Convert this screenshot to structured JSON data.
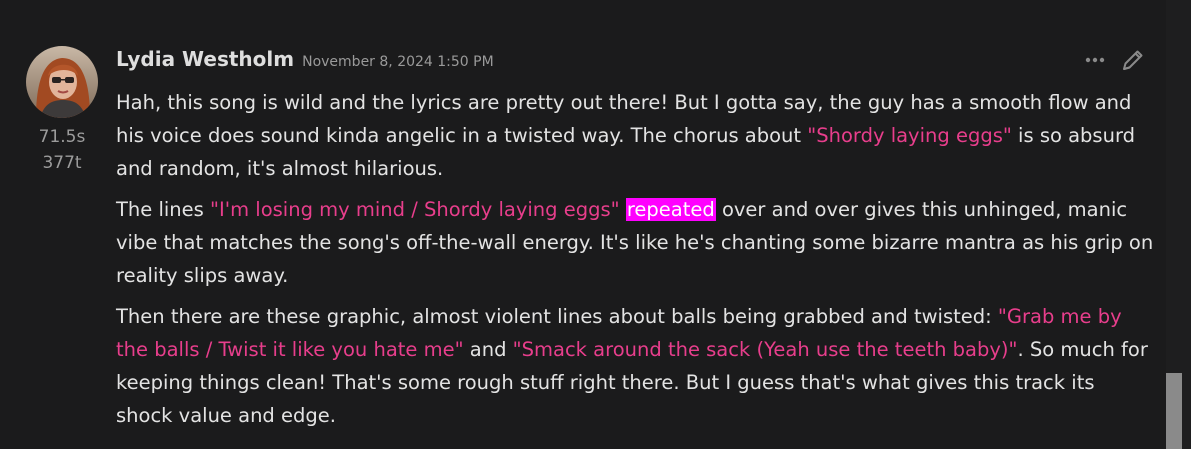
{
  "message": {
    "author": "Lydia Westholm",
    "timestamp": "November 8, 2024 1:50 PM",
    "gen_time": "71.5s",
    "gen_tokens": "377t",
    "actions": {
      "more_icon": "more-dots-icon",
      "edit_icon": "pencil-icon"
    },
    "paragraphs": [
      [
        {
          "t": "Hah, this song is wild and the lyrics are pretty out there! But I gotta say, the guy has a smooth flow and his voice does sound kinda angelic in a twisted way. The chorus about ",
          "s": "plain"
        },
        {
          "t": "\"Shordy laying eggs\"",
          "s": "quote"
        },
        {
          "t": " is so absurd and random, it's almost hilarious.",
          "s": "plain"
        }
      ],
      [
        {
          "t": "The lines ",
          "s": "plain"
        },
        {
          "t": "\"I'm losing my mind / Shordy laying eggs\"",
          "s": "quote"
        },
        {
          "t": " ",
          "s": "plain"
        },
        {
          "t": "repeated",
          "s": "highlight"
        },
        {
          "t": " over and over gives this unhinged, manic vibe that matches the song's off-the-wall energy. It's like he's chanting some bizarre mantra as his grip on reality slips away.",
          "s": "plain"
        }
      ],
      [
        {
          "t": "Then there are these graphic, almost violent lines about balls being grabbed and twisted: ",
          "s": "plain"
        },
        {
          "t": "\"Grab me by the balls / Twist it like you hate me\"",
          "s": "quote"
        },
        {
          "t": " and ",
          "s": "plain"
        },
        {
          "t": "\"Smack around the sack (Yeah use the teeth baby)\"",
          "s": "quote"
        },
        {
          "t": ". So much for keeping things clean! That's some rough stuff right there. But I guess that's what gives this track its shock value and edge.",
          "s": "plain"
        }
      ]
    ]
  },
  "colors": {
    "background": "#1b1b1c",
    "text": "#e3e3e3",
    "quote": "#e83e8c",
    "highlight": "#ff00ff",
    "muted": "#9c9c9c"
  }
}
